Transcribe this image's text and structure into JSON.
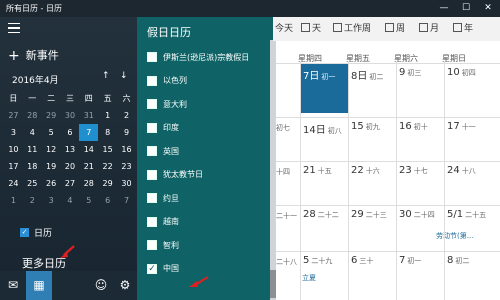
{
  "window": {
    "title": "所有日历 - 日历",
    "minimize": "—",
    "maximize": "☐",
    "close": "✕"
  },
  "sidebar": {
    "new_event": "新事件",
    "month": "2016年4月",
    "weekdays": [
      "日",
      "一",
      "二",
      "三",
      "四",
      "五",
      "六"
    ],
    "weeks": [
      [
        {
          "d": "27",
          "o": true
        },
        {
          "d": "28",
          "o": true
        },
        {
          "d": "29",
          "o": true
        },
        {
          "d": "30",
          "o": true
        },
        {
          "d": "31",
          "o": true
        },
        {
          "d": "1"
        },
        {
          "d": "2"
        }
      ],
      [
        {
          "d": "3"
        },
        {
          "d": "4"
        },
        {
          "d": "5"
        },
        {
          "d": "6"
        },
        {
          "d": "7",
          "t": true
        },
        {
          "d": "8"
        },
        {
          "d": "9"
        }
      ],
      [
        {
          "d": "10"
        },
        {
          "d": "11"
        },
        {
          "d": "12"
        },
        {
          "d": "13"
        },
        {
          "d": "14"
        },
        {
          "d": "15"
        },
        {
          "d": "16"
        }
      ],
      [
        {
          "d": "17"
        },
        {
          "d": "18"
        },
        {
          "d": "19"
        },
        {
          "d": "20"
        },
        {
          "d": "21"
        },
        {
          "d": "22"
        },
        {
          "d": "23"
        }
      ],
      [
        {
          "d": "24"
        },
        {
          "d": "25"
        },
        {
          "d": "26"
        },
        {
          "d": "27"
        },
        {
          "d": "28"
        },
        {
          "d": "29"
        },
        {
          "d": "30"
        }
      ],
      [
        {
          "d": "1",
          "o": true
        },
        {
          "d": "2",
          "o": true
        },
        {
          "d": "3",
          "o": true
        },
        {
          "d": "4",
          "o": true
        },
        {
          "d": "5",
          "o": true
        },
        {
          "d": "6",
          "o": true
        },
        {
          "d": "7",
          "o": true
        }
      ]
    ],
    "calendar_label": "日历",
    "more_calendars": "更多日历"
  },
  "holiday_panel": {
    "title": "假日日历",
    "items": [
      {
        "label": "伊斯兰(逊尼派)宗教假日",
        "checked": false
      },
      {
        "label": "以色列",
        "checked": false
      },
      {
        "label": "意大利",
        "checked": false
      },
      {
        "label": "印度",
        "checked": false
      },
      {
        "label": "英国",
        "checked": false
      },
      {
        "label": "犹太教节日",
        "checked": false
      },
      {
        "label": "约旦",
        "checked": false
      },
      {
        "label": "越南",
        "checked": false
      },
      {
        "label": "智利",
        "checked": false
      },
      {
        "label": "中国",
        "checked": true
      }
    ]
  },
  "toolbar": {
    "today": "今天",
    "day": "天",
    "workweek": "工作周",
    "week": "周",
    "month": "月",
    "year": "年"
  },
  "weekdays_header": [
    "星期四",
    "星期五",
    "星期六",
    "星期日"
  ],
  "rows": [
    {
      "lead": "",
      "cells": [
        {
          "d": "7日",
          "l": "初一",
          "today": true
        },
        {
          "d": "8日",
          "l": "初二"
        },
        {
          "d": "9",
          "l": "初三"
        },
        {
          "d": "10",
          "l": "初四"
        }
      ]
    },
    {
      "lead": "初七",
      "cells": [
        {
          "d": "14日",
          "l": "初八"
        },
        {
          "d": "15",
          "l": "初九"
        },
        {
          "d": "16",
          "l": "初十"
        },
        {
          "d": "17",
          "l": "十一"
        }
      ]
    },
    {
      "lead": "十四",
      "cells": [
        {
          "d": "21",
          "l": "十五"
        },
        {
          "d": "22",
          "l": "十六"
        },
        {
          "d": "23",
          "l": "十七"
        },
        {
          "d": "24",
          "l": "十八"
        }
      ]
    },
    {
      "lead": "二十一",
      "cells": [
        {
          "d": "28",
          "l": "二十二"
        },
        {
          "d": "29",
          "l": "二十三"
        },
        {
          "d": "30",
          "l": "二十四"
        },
        {
          "d": "5/1",
          "l": "二十五"
        }
      ]
    },
    {
      "lead": "二十八",
      "cells": [
        {
          "d": "5",
          "l": "二十九"
        },
        {
          "d": "6",
          "l": "三十"
        },
        {
          "d": "7",
          "l": "初一"
        },
        {
          "d": "8",
          "l": "初二"
        }
      ]
    }
  ],
  "holidays": {
    "labor_day": "劳动节(第...",
    "lixia": "立夏"
  }
}
